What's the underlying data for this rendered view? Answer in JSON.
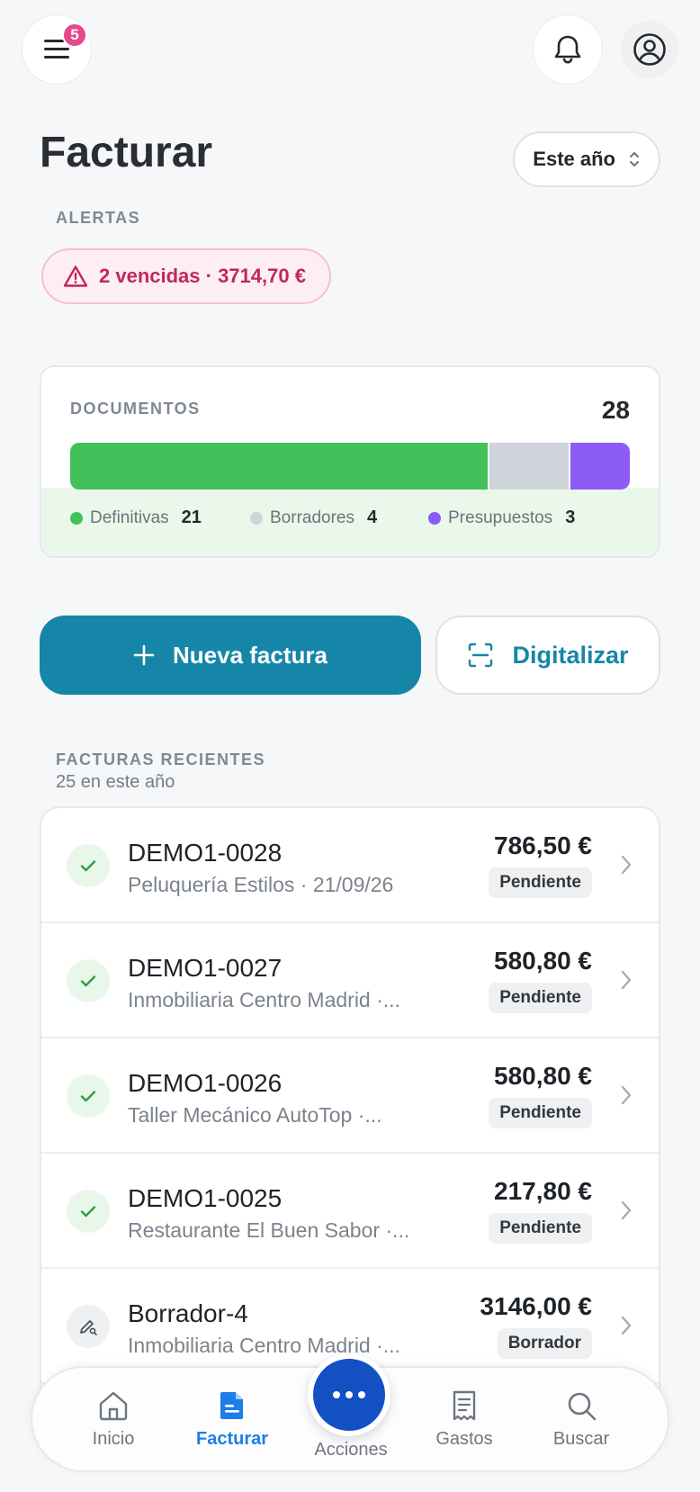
{
  "header": {
    "menu_badge": "5",
    "title": "Facturar",
    "period": "Este año"
  },
  "alerts": {
    "label": "ALERTAS",
    "pill": "2 vencidas · 3714,70 €"
  },
  "documents": {
    "label": "DOCUMENTOS",
    "total": "28",
    "segments": [
      {
        "name": "Definitivas",
        "count": 21,
        "color": "#42c15a"
      },
      {
        "name": "Borradores",
        "count": 4,
        "color": "#cfd4da"
      },
      {
        "name": "Presupuestos",
        "count": 3,
        "color": "#8b5cf6"
      }
    ]
  },
  "actions": {
    "new_invoice": "Nueva factura",
    "digitize": "Digitalizar"
  },
  "recent": {
    "label": "FACTURAS RECIENTES",
    "subtitle": "25 en este año",
    "items": [
      {
        "number": "DEMO1-0028",
        "client": "Peluquería Estilos · 21/09/26",
        "amount": "786,50 €",
        "status": "Pendiente",
        "type": "ok"
      },
      {
        "number": "DEMO1-0027",
        "client": "Inmobiliaria Centro Madrid ·...",
        "amount": "580,80 €",
        "status": "Pendiente",
        "type": "ok"
      },
      {
        "number": "DEMO1-0026",
        "client": "Taller Mecánico AutoTop ·...",
        "amount": "580,80 €",
        "status": "Pendiente",
        "type": "ok"
      },
      {
        "number": "DEMO1-0025",
        "client": "Restaurante El Buen Sabor ·...",
        "amount": "217,80 €",
        "status": "Pendiente",
        "type": "ok"
      },
      {
        "number": "Borrador-4",
        "client": "Inmobiliaria Centro Madrid ·...",
        "amount": "3146,00 €",
        "status": "Borrador",
        "type": "draft"
      }
    ]
  },
  "nav": {
    "home": "Inicio",
    "invoice": "Facturar",
    "actions": "Acciones",
    "expenses": "Gastos",
    "search": "Buscar"
  },
  "colors": {
    "accent": "#1686a8",
    "nav_active": "#1c7ee8",
    "alert": "#c0275f",
    "fab": "#1250c4"
  }
}
